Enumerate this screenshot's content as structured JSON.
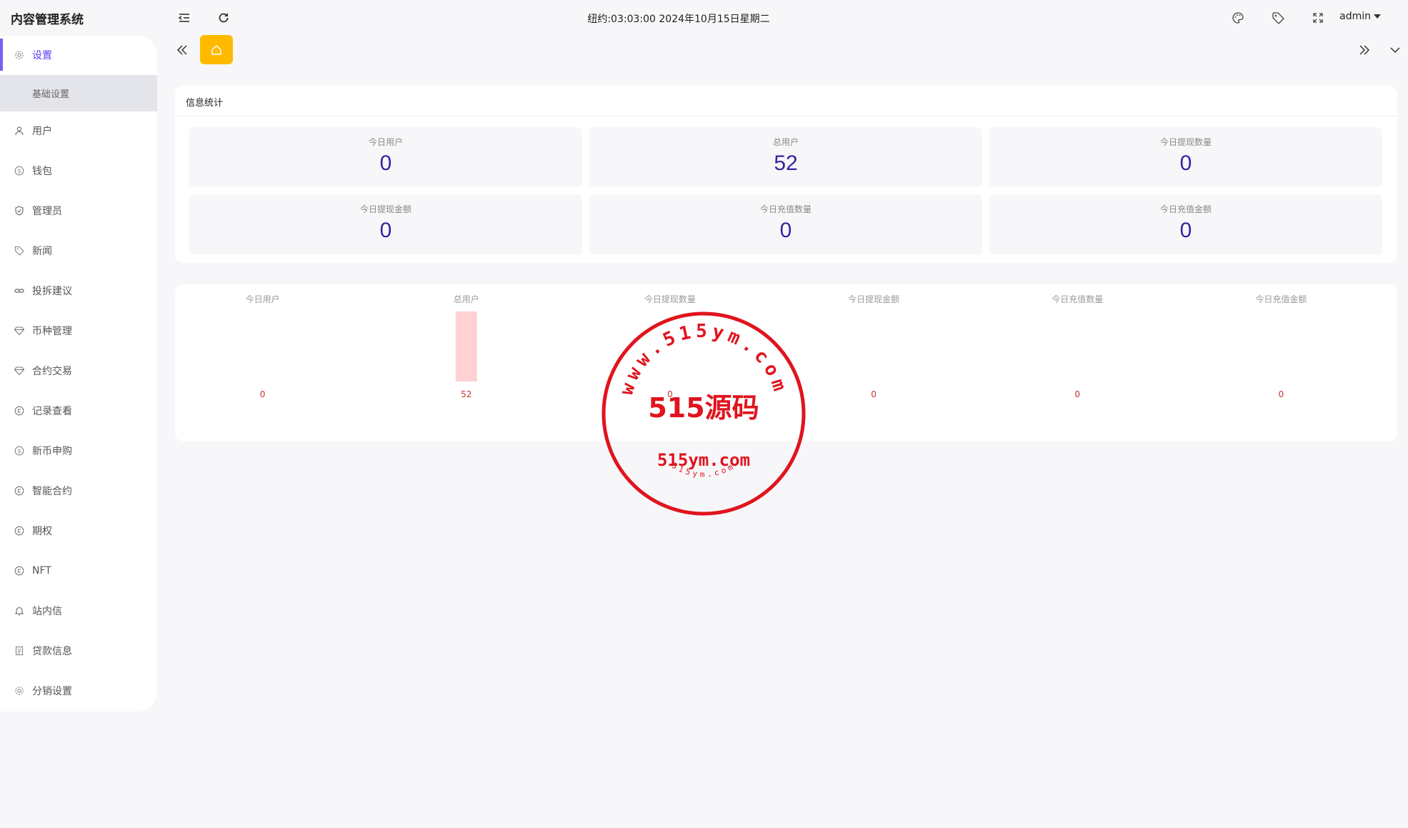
{
  "header": {
    "app_title": "内容管理系统",
    "datetime": "纽约:03:03:00 2024年10月15日星期二",
    "user": "admin",
    "icons": [
      "menu-fold-icon",
      "refresh-icon",
      "palette-icon",
      "tag-icon",
      "fullscreen-icon"
    ]
  },
  "sidebar": {
    "items": [
      {
        "label": "设置",
        "icon": "gear-icon",
        "active": true
      },
      {
        "label": "用户",
        "icon": "user-icon"
      },
      {
        "label": "钱包",
        "icon": "dollar-icon"
      },
      {
        "label": "管理员",
        "icon": "shield-icon"
      },
      {
        "label": "新闻",
        "icon": "tag-icon"
      },
      {
        "label": "投拆建议",
        "icon": "link-icon"
      },
      {
        "label": "币种管理",
        "icon": "diamond-icon"
      },
      {
        "label": "合约交易",
        "icon": "diamond-icon"
      },
      {
        "label": "记录查看",
        "icon": "circle-arrow-icon"
      },
      {
        "label": "新币申购",
        "icon": "dollar-icon"
      },
      {
        "label": "智能合约",
        "icon": "circle-arrow-icon"
      },
      {
        "label": "期权",
        "icon": "circle-arrow-icon"
      },
      {
        "label": "NFT",
        "icon": "circle-arrow-icon"
      },
      {
        "label": "站内信",
        "icon": "bell-icon"
      },
      {
        "label": "贷款信息",
        "icon": "document-icon"
      },
      {
        "label": "分销设置",
        "icon": "gear-icon"
      }
    ],
    "sub_items": [
      {
        "label": "基础设置"
      }
    ]
  },
  "stats": {
    "title": "信息统计",
    "boxes": [
      {
        "label": "今日用户",
        "value": "0"
      },
      {
        "label": "总用户",
        "value": "52"
      },
      {
        "label": "今日提现数量",
        "value": "0"
      },
      {
        "label": "今日提现金额",
        "value": "0"
      },
      {
        "label": "今日充值数量",
        "value": "0"
      },
      {
        "label": "今日充值金额",
        "value": "0"
      }
    ]
  },
  "watermark": {
    "ring_text": "www.515ym.com",
    "center_text": "515源码",
    "domain_text": "515ym.com",
    "small_ring_text": "515ym.com",
    "color": "#e0141e"
  },
  "chart_data": {
    "type": "bar",
    "categories": [
      "今日用户",
      "总用户",
      "今日提现数量",
      "今日提现金额",
      "今日充值数量",
      "今日充值金额"
    ],
    "values": [
      0,
      52,
      0,
      0,
      0,
      0
    ],
    "data_labels": [
      "0",
      "52",
      "0",
      "0",
      "0",
      "0"
    ],
    "bar_color": "#ffd1d4",
    "label_color": "#c0392b",
    "grid": false,
    "legend": false
  }
}
